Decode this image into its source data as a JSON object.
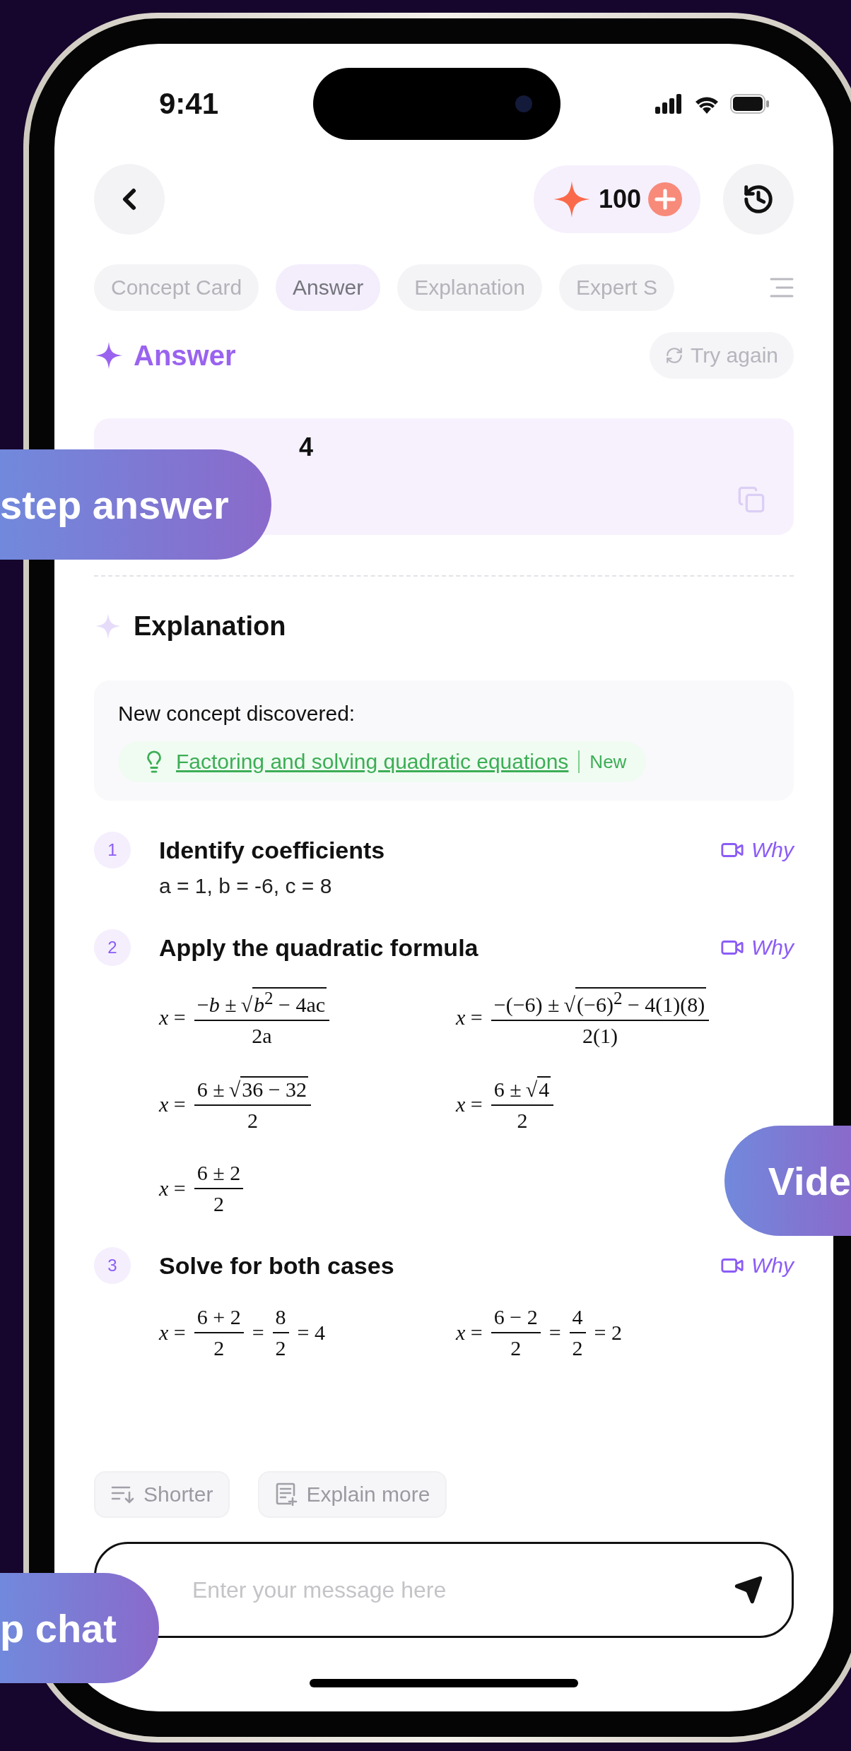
{
  "status_bar": {
    "time": "9:41"
  },
  "header": {
    "credits": "100"
  },
  "tabs": [
    {
      "label": "Concept Card",
      "selected": false
    },
    {
      "label": "Answer",
      "selected": true
    },
    {
      "label": "Explanation",
      "selected": false
    },
    {
      "label": "Expert S",
      "selected": false
    }
  ],
  "answer": {
    "title": "Answer",
    "try_again": "Try again",
    "value": "4"
  },
  "explanation": {
    "title": "Explanation",
    "concept_heading": "New concept discovered:",
    "concept_link": "Factoring and solving quadratic equations",
    "concept_badge": "New"
  },
  "steps": [
    {
      "number": "1",
      "title": "Identify coefficients",
      "why": "Why",
      "detail": "a = 1, b = -6, c = 8"
    },
    {
      "number": "2",
      "title": "Apply the quadratic formula",
      "why": "Why",
      "formula_rows": [
        [
          [
            {
              "kind": "text",
              "text": "*x* ="
            },
            {
              "kind": "frac",
              "num": [
                {
                  "kind": "text",
                  "text": "−*b* ±"
                },
                {
                  "kind": "sqrt",
                  "sign": "√",
                  "text": "*b*$^{2}$ − 4ac"
                }
              ],
              "den": "2a"
            }
          ],
          [
            {
              "kind": "text",
              "text": "*x* ="
            },
            {
              "kind": "frac",
              "num": [
                {
                  "kind": "text",
                  "text": "−(−6) ±"
                },
                {
                  "kind": "sqrt",
                  "sign": "√",
                  "text": "(−6)$^{2}$ − 4(1)(8)"
                }
              ],
              "den": "2(1)"
            }
          ]
        ],
        [
          [
            {
              "kind": "text",
              "text": "*x* ="
            },
            {
              "kind": "frac",
              "num": [
                {
                  "kind": "text",
                  "text": "6 ±"
                },
                {
                  "kind": "sqrt",
                  "sign": "√",
                  "text": "36 − 32"
                }
              ],
              "den": "2"
            }
          ],
          [
            {
              "kind": "text",
              "text": "*x* ="
            },
            {
              "kind": "frac",
              "num": [
                {
                  "kind": "text",
                  "text": "6 ±"
                },
                {
                  "kind": "sqrt",
                  "sign": "√",
                  "text": "4"
                }
              ],
              "den": "2"
            }
          ]
        ],
        [
          [
            {
              "kind": "text",
              "text": "*x* ="
            },
            {
              "kind": "frac",
              "num": [
                {
                  "kind": "text",
                  "text": "6 ± 2"
                }
              ],
              "den": "2"
            }
          ]
        ]
      ]
    },
    {
      "number": "3",
      "title": "Solve for both cases",
      "why": "Why",
      "formula_rows": [
        [
          [
            {
              "kind": "text",
              "text": "*x* ="
            },
            {
              "kind": "frac",
              "num": [
                {
                  "kind": "text",
                  "text": "6 + 2"
                }
              ],
              "den": "2"
            },
            {
              "kind": "text",
              "text": "="
            },
            {
              "kind": "frac",
              "num": [
                {
                  "kind": "text",
                  "text": "8"
                }
              ],
              "den": "2"
            },
            {
              "kind": "text",
              "text": "= 4"
            }
          ],
          [
            {
              "kind": "text",
              "text": "*x* ="
            },
            {
              "kind": "frac",
              "num": [
                {
                  "kind": "text",
                  "text": "6 − 2"
                }
              ],
              "den": "2"
            },
            {
              "kind": "text",
              "text": "="
            },
            {
              "kind": "frac",
              "num": [
                {
                  "kind": "text",
                  "text": "4"
                }
              ],
              "den": "2"
            },
            {
              "kind": "text",
              "text": "= 2"
            }
          ]
        ]
      ]
    }
  ],
  "actions": [
    {
      "kind": "shorter",
      "label": "Shorter"
    },
    {
      "kind": "explain",
      "label": "Explain more"
    }
  ],
  "composer": {
    "placeholder": "Enter your message here"
  },
  "callouts": [
    {
      "text": "step answer"
    },
    {
      "text": "Vide"
    },
    {
      "text": "p chat"
    }
  ]
}
